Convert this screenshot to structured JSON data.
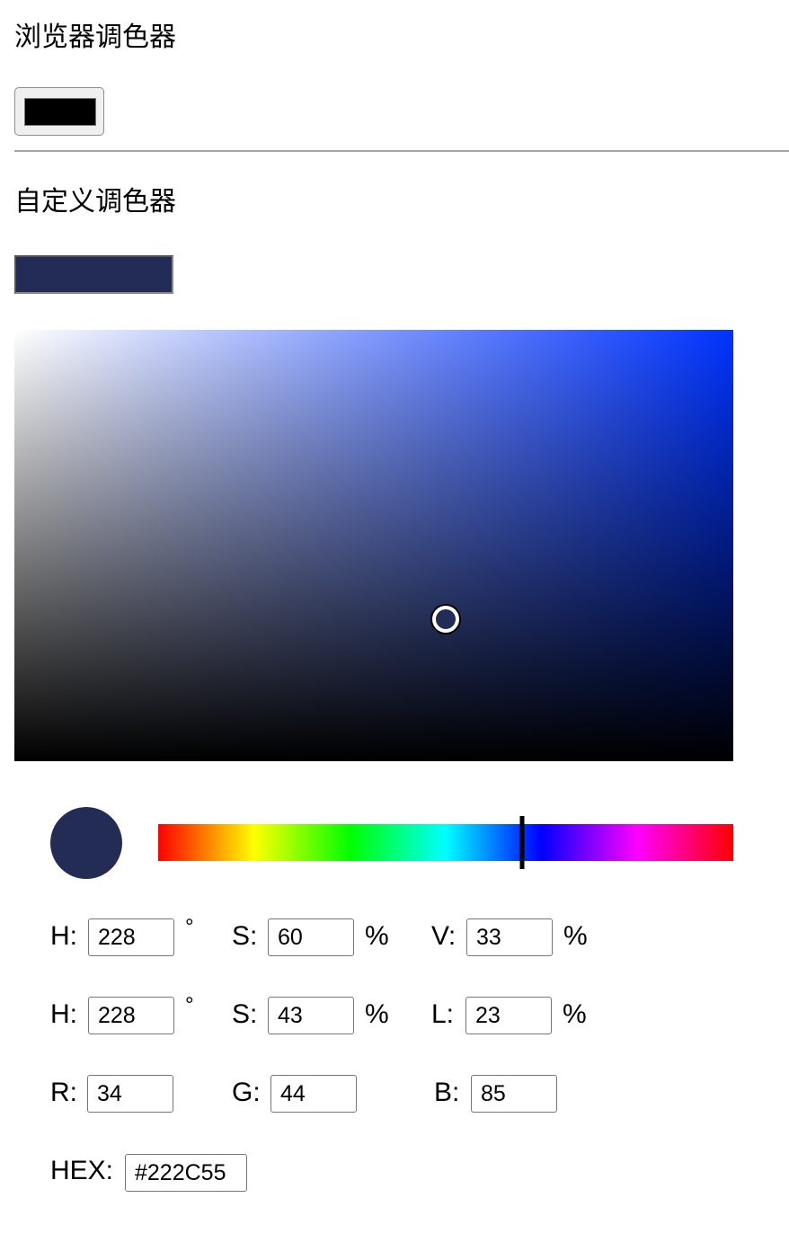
{
  "browser_picker": {
    "title": "浏览器调色器",
    "swatch_color": "#000000"
  },
  "custom_picker": {
    "title": "自定义调色器",
    "current_color": "#222C55",
    "sv_area": {
      "hue_color": "#0033ff",
      "saturation": 0.6,
      "value": 0.33
    },
    "hue_slider": {
      "value": 228,
      "max": 360
    },
    "hsv": {
      "h_label": "H:",
      "h": "228",
      "h_unit": "°",
      "s_label": "S:",
      "s": "60",
      "s_unit": "%",
      "v_label": "V:",
      "v": "33",
      "v_unit": "%"
    },
    "hsl": {
      "h_label": "H:",
      "h": "228",
      "h_unit": "°",
      "s_label": "S:",
      "s": "43",
      "s_unit": "%",
      "l_label": "L:",
      "l": "23",
      "l_unit": "%"
    },
    "rgb": {
      "r_label": "R:",
      "r": "34",
      "g_label": "G:",
      "g": "44",
      "b_label": "B:",
      "b": "85"
    },
    "hex": {
      "label": "HEX:",
      "value": "#222C55"
    }
  }
}
